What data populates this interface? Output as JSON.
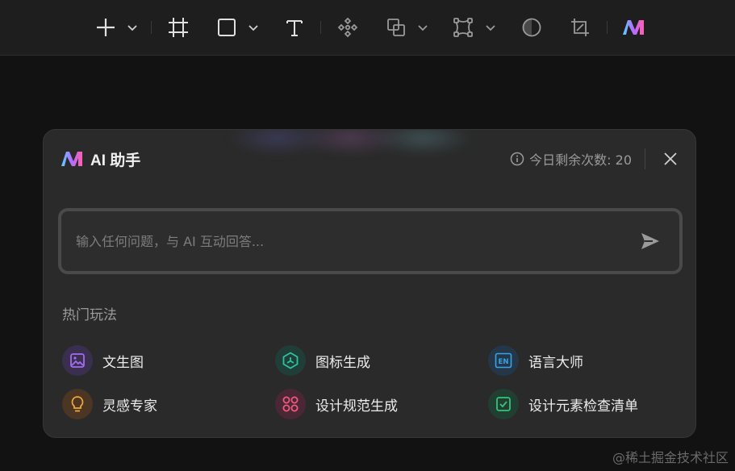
{
  "toolbar": {
    "icons": [
      "plus-icon",
      "chevron-down-icon",
      "frame-icon",
      "rectangle-icon",
      "chevron-down-icon",
      "text-icon",
      "component-icon",
      "boolean-icon",
      "chevron-down-icon",
      "vector-icon",
      "chevron-down-icon",
      "circle-icon",
      "crop-icon",
      "ai-logo-icon"
    ]
  },
  "panel": {
    "title": "AI 助手",
    "quota": "今日剩余次数: 20",
    "input_placeholder": "输入任何问题，与 AI 互动回答...",
    "section_label": "热门玩法",
    "features": [
      {
        "label": "文生图",
        "icon": "image-icon",
        "color": "#a46cf0",
        "bg": "#3a2f4f"
      },
      {
        "label": "图标生成",
        "icon": "hexagon-cube-icon",
        "color": "#2bc4a0",
        "bg": "#203d38"
      },
      {
        "label": "语言大师",
        "icon": "en-icon",
        "color": "#3aa3e8",
        "bg": "#233748"
      },
      {
        "label": "灵感专家",
        "icon": "lightbulb-icon",
        "color": "#f2a63a",
        "bg": "#4a3622"
      },
      {
        "label": "设计规范生成",
        "icon": "grid-circles-icon",
        "color": "#f0587e",
        "bg": "#4a2735"
      },
      {
        "label": "设计元素检查清单",
        "icon": "check-box-icon",
        "color": "#35c47a",
        "bg": "#213f30"
      }
    ]
  },
  "watermark": "@稀土掘金技术社区"
}
